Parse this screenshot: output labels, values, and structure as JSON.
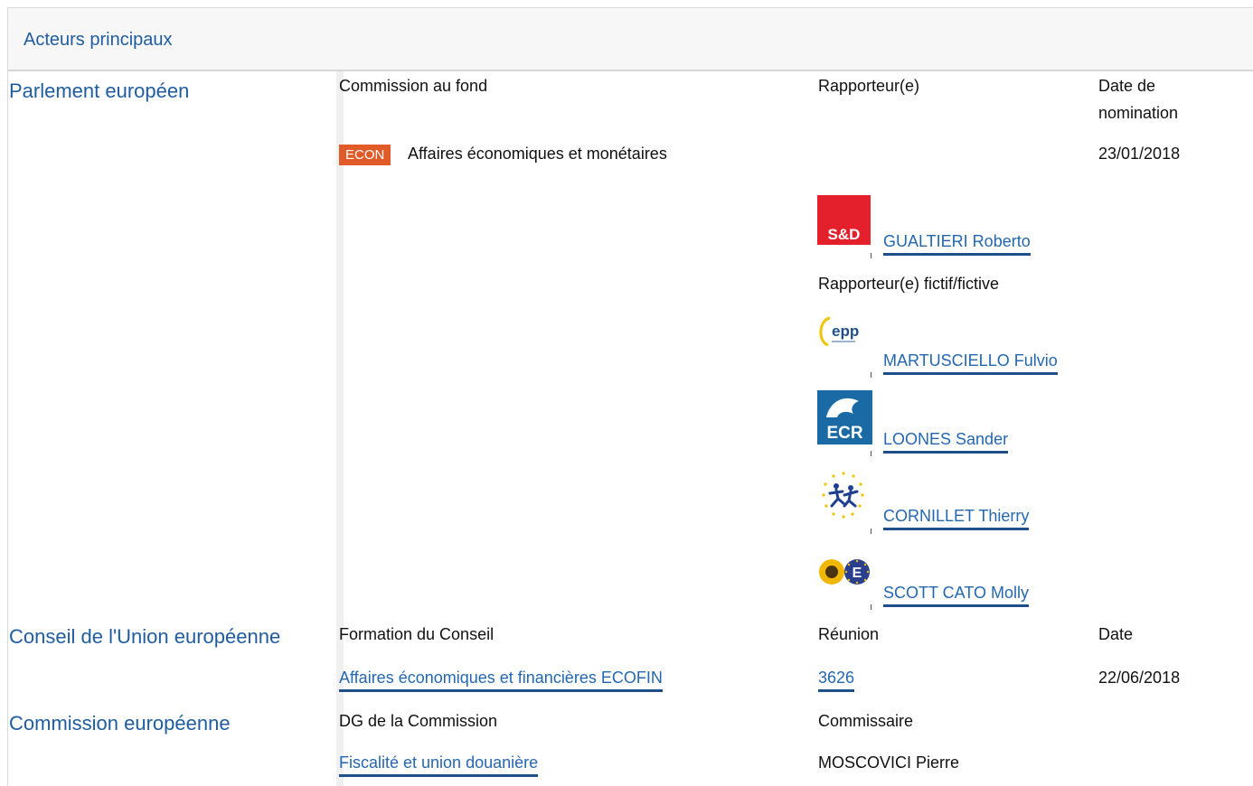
{
  "section_title": "Acteurs principaux",
  "parliament": {
    "name": "Parlement européen",
    "headers": {
      "committee": "Commission au fond",
      "rapporteur": "Rapporteur(e)",
      "date_line1": "Date de",
      "date_line2": "nomination"
    },
    "committee_badge": "ECON",
    "committee_name": "Affaires économiques et monétaires",
    "nomination_date": "23/01/2018",
    "rapporteur": {
      "group_logo": "S&D",
      "name": "GUALTIERI Roberto"
    },
    "shadow_label": "Rapporteur(e) fictif/fictive",
    "shadows": [
      {
        "group_logo": "epp",
        "name": "MARTUSCIELLO Fulvio"
      },
      {
        "group_logo": "ECR",
        "name": "LOONES Sander"
      },
      {
        "group_logo": "alde-stars",
        "name": "CORNILLET Thierry"
      },
      {
        "group_logo": "greens-efa-sunflower",
        "name": "SCOTT CATO Molly"
      }
    ]
  },
  "council": {
    "name": "Conseil de l'Union européenne",
    "headers": {
      "formation": "Formation du Conseil",
      "meeting": "Réunion",
      "date": "Date"
    },
    "formation": "Affaires économiques et financières ECOFIN",
    "meeting": "3626",
    "date": "22/06/2018"
  },
  "commission": {
    "name": "Commission européenne",
    "headers": {
      "dg": "DG de la Commission",
      "commissioner": "Commissaire"
    },
    "dg": "Fiscalité et union douanière",
    "commissioner": "MOSCOVICI Pierre"
  },
  "colors": {
    "link": "#2467b1",
    "institution": "#1f5da0",
    "econ_badge": "#e05b28",
    "sd_red": "#e3202b",
    "ecr_blue": "#1a6aa6"
  }
}
